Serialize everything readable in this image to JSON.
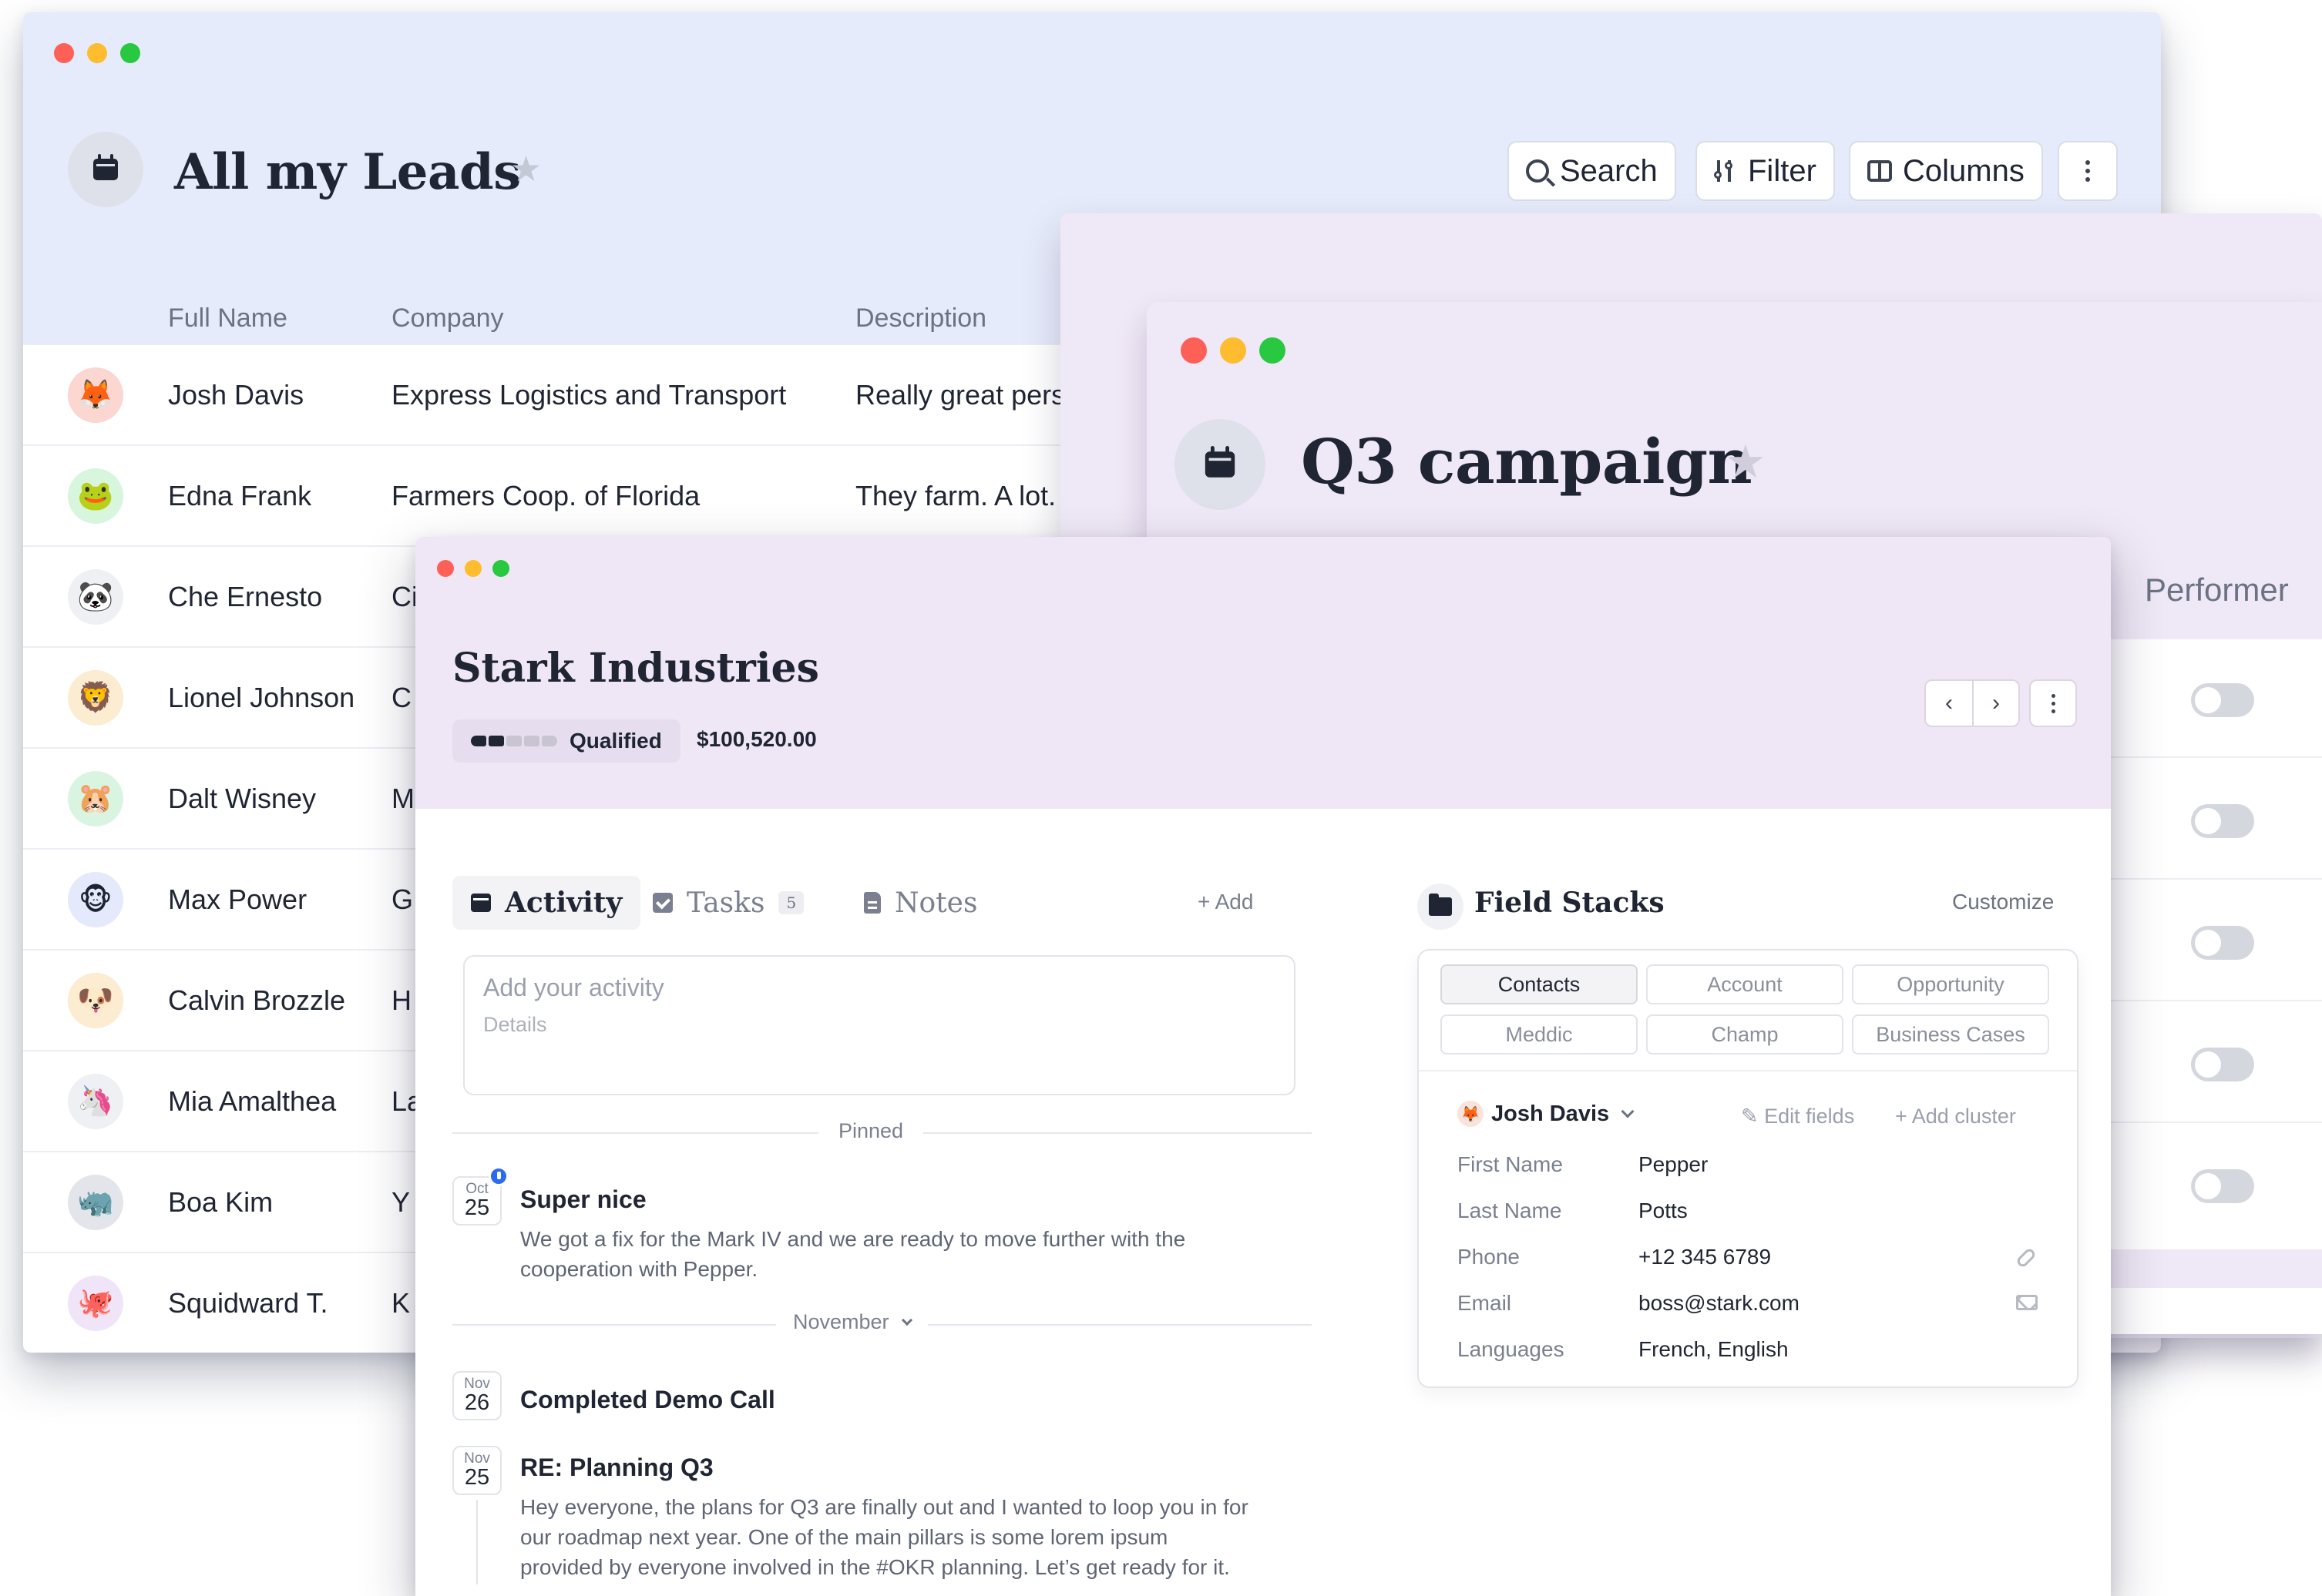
{
  "leads_window": {
    "title": "All my Leads",
    "toolbar": {
      "search_label": "Search",
      "filter_label": "Filter",
      "columns_label": "Columns"
    },
    "columns": [
      "Full Name",
      "Company",
      "Description"
    ],
    "rows": [
      {
        "avatar": "🦊",
        "avatar_bg": "#fcd6d0",
        "name": "Josh Davis",
        "company": "Express Logistics and Transport",
        "description": "Really great pers"
      },
      {
        "avatar": "🐸",
        "avatar_bg": "#d8f5de",
        "name": "Edna Frank",
        "company": "Farmers Coop. of Florida",
        "description": "They farm. A lot."
      },
      {
        "avatar": "🐼",
        "avatar_bg": "#eef0f4",
        "name": "Che Ernesto",
        "company": "Ci",
        "description": ""
      },
      {
        "avatar": "🦁",
        "avatar_bg": "#fbecd2",
        "name": "Lionel Johnson",
        "company": "C",
        "description": ""
      },
      {
        "avatar": "🐹",
        "avatar_bg": "#daf4e2",
        "name": "Dalt Wisney",
        "company": "M",
        "description": ""
      },
      {
        "avatar": "🐵",
        "avatar_bg": "#e4e9fb",
        "name": "Max Power",
        "company": "G",
        "description": ""
      },
      {
        "avatar": "🐶",
        "avatar_bg": "#fbecd2",
        "name": "Calvin Brozzle",
        "company": "H",
        "description": ""
      },
      {
        "avatar": "🦄",
        "avatar_bg": "#eef0f4",
        "name": "Mia Amalthea",
        "company": "La",
        "description": ""
      },
      {
        "avatar": "🦏",
        "avatar_bg": "#e4e5ea",
        "name": "Boa Kim",
        "company": "Y",
        "description": ""
      },
      {
        "avatar": "🐙",
        "avatar_bg": "#f0e4f8",
        "name": "Squidward T.",
        "company": "K",
        "description": ""
      }
    ]
  },
  "q3_window": {
    "title": "Q3 campaign",
    "visible_column": "Performer",
    "toggles": [
      false,
      false,
      false,
      false,
      false
    ]
  },
  "stark_window": {
    "title": "Stark Industries",
    "stage": {
      "label": "Qualified",
      "progress_steps_total": 5,
      "progress_steps_done": 2
    },
    "amount": "$100,520.00",
    "tabs": [
      {
        "label": "Activity",
        "icon": "calendar-icon",
        "active": true
      },
      {
        "label": "Tasks",
        "icon": "task-check-icon",
        "count": "5"
      },
      {
        "label": "Notes",
        "icon": "note-icon"
      }
    ],
    "add_label": "+ Add",
    "activity_input": {
      "placeholder": "Add your activity",
      "details_placeholder": "Details"
    },
    "pinned_label": "Pinned",
    "month_label": "November",
    "activities": [
      {
        "month": "Oct",
        "day": "25",
        "title": "Super nice",
        "body_line1": "We got a fix for the Mark IV and we are ready to move further with the",
        "body_line2": "cooperation with Pepper."
      },
      {
        "month": "Nov",
        "day": "26",
        "title": "Completed Demo Call"
      },
      {
        "month": "Nov",
        "day": "25",
        "title": "RE: Planning Q3",
        "body_line1": "Hey everyone, the plans for Q3 are finally out and I wanted to loop you in for",
        "body_line2": "our roadmap next year. One of the main pillars is some lorem ipsum",
        "body_line3": "provided by everyone involved in the #OKR planning. Let’s get ready for it."
      }
    ],
    "field_stacks": {
      "title": "Field Stacks",
      "customize_label": "Customize",
      "chips": [
        "Contacts",
        "Account",
        "Opportunity",
        "Meddic",
        "Champ",
        "Business Cases"
      ],
      "contact_avatar": "🦊",
      "contact_name": "Josh Davis",
      "edit_fields_label": "Edit fields",
      "add_cluster_label": "+ Add cluster",
      "fields": [
        {
          "label": "First Name",
          "value": "Pepper"
        },
        {
          "label": "Last Name",
          "value": "Potts"
        },
        {
          "label": "Phone",
          "value": "+12 345 6789"
        },
        {
          "label": "Email",
          "value": "boss@stark.com"
        },
        {
          "label": "Languages",
          "value": "French, English"
        }
      ]
    }
  },
  "colors": {
    "leads_header_bg": "#e6ebfb",
    "campaign_header_bg": "#efe8f6",
    "stark_header_bg": "#f0e7f6",
    "pin_blue": "#2a6bf0"
  }
}
